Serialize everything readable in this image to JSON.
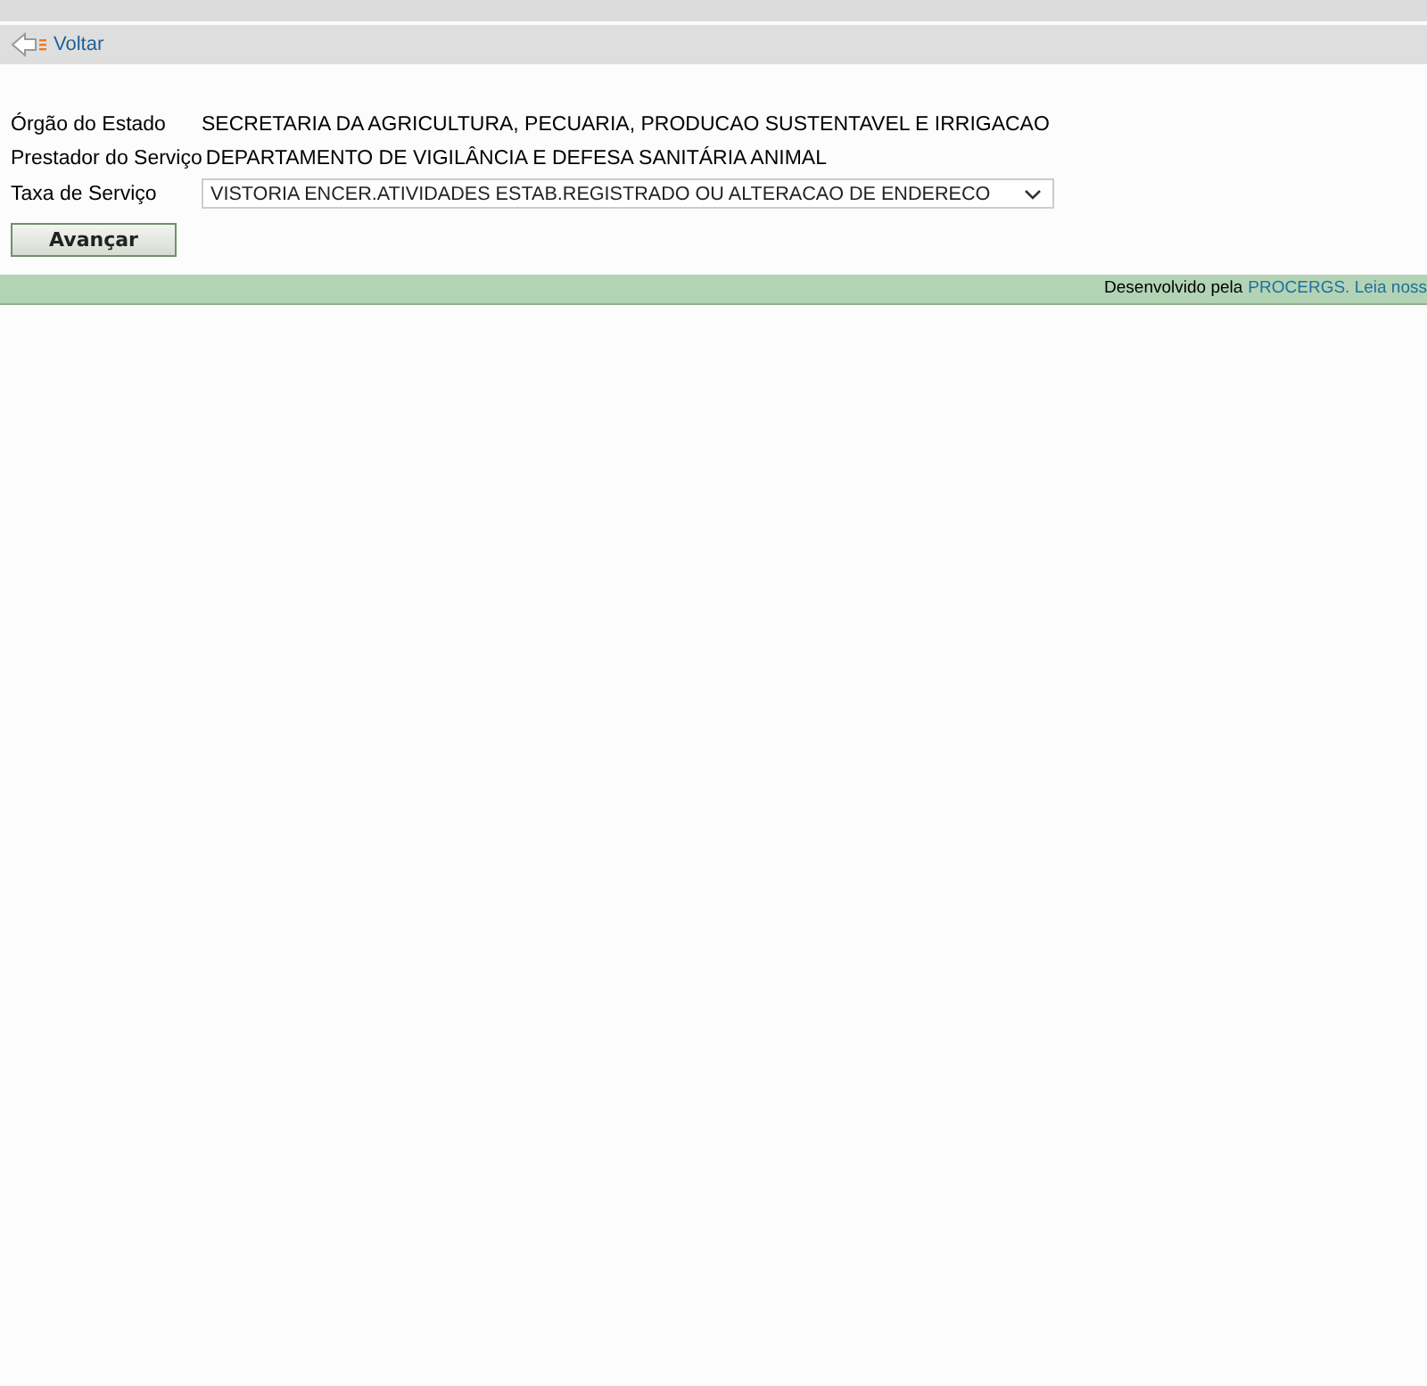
{
  "nav": {
    "back_link": "Voltar"
  },
  "fields": [
    {
      "kind": "text",
      "label": "Órgão do Estado",
      "value": "SECRETARIA DA AGRICULTURA, PECUARIA, PRODUCAO SUSTENTAVEL E IRRIGACAO"
    },
    {
      "kind": "text",
      "label": "Prestador do Serviço",
      "value": "DEPARTAMENTO DE VIGILÂNCIA E DEFESA SANITÁRIA ANIMAL"
    },
    {
      "kind": "select",
      "label": "Taxa de Serviço",
      "value": "VISTORIA ENCER.ATIVIDADES ESTAB.REGISTRADO OU ALTERACAO DE ENDERECO"
    }
  ],
  "submit_button": "Avançar",
  "footer": {
    "text": "Desenvolvido pela",
    "link": "PROCERGS",
    "link2": ". Leia noss"
  }
}
